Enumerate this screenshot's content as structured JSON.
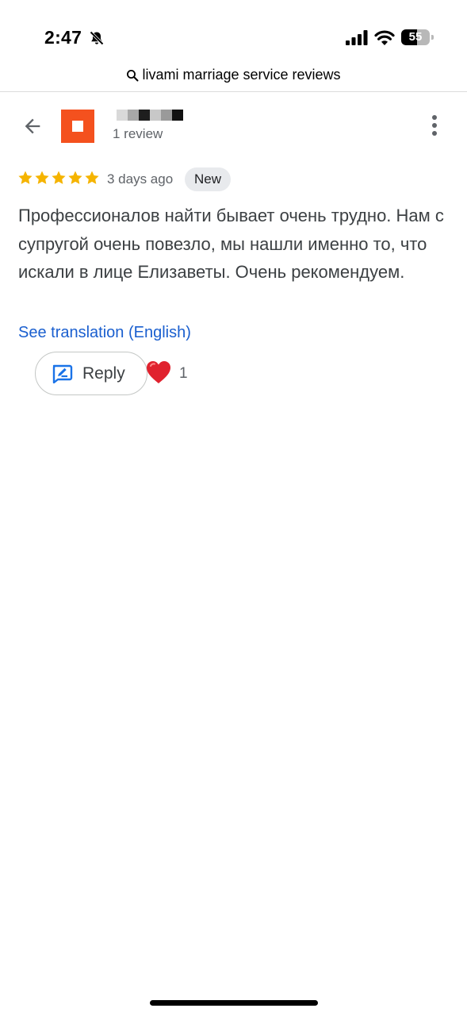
{
  "status_bar": {
    "time": "2:47",
    "battery_percent": "55",
    "battery_level": 0.55,
    "icons": [
      "bell-muted-icon",
      "cellular-signal-icon",
      "wifi-icon",
      "battery-icon"
    ]
  },
  "search": {
    "query": "livami marriage service reviews",
    "icon": "search-icon"
  },
  "review": {
    "reviewer_name": "",
    "review_count": "1 review",
    "avatar_color": "#f4511e",
    "rating": 5,
    "time_ago": "3 days ago",
    "badge": "New",
    "text": "Профессионалов найти бывает очень трудно. Нам с супругой очень повезло, мы нашли именно то, что искали в лице Елизаветы. Очень рекомендуем.",
    "translate_link": "See translation (English)"
  },
  "actions": {
    "reply_label": "Reply",
    "reaction_icon": "heart-icon",
    "reaction_count": "1"
  },
  "colors": {
    "star": "#f5b400",
    "link": "#1a5fcf",
    "reply_icon": "#1a73e8",
    "heart": "#e0222e"
  }
}
